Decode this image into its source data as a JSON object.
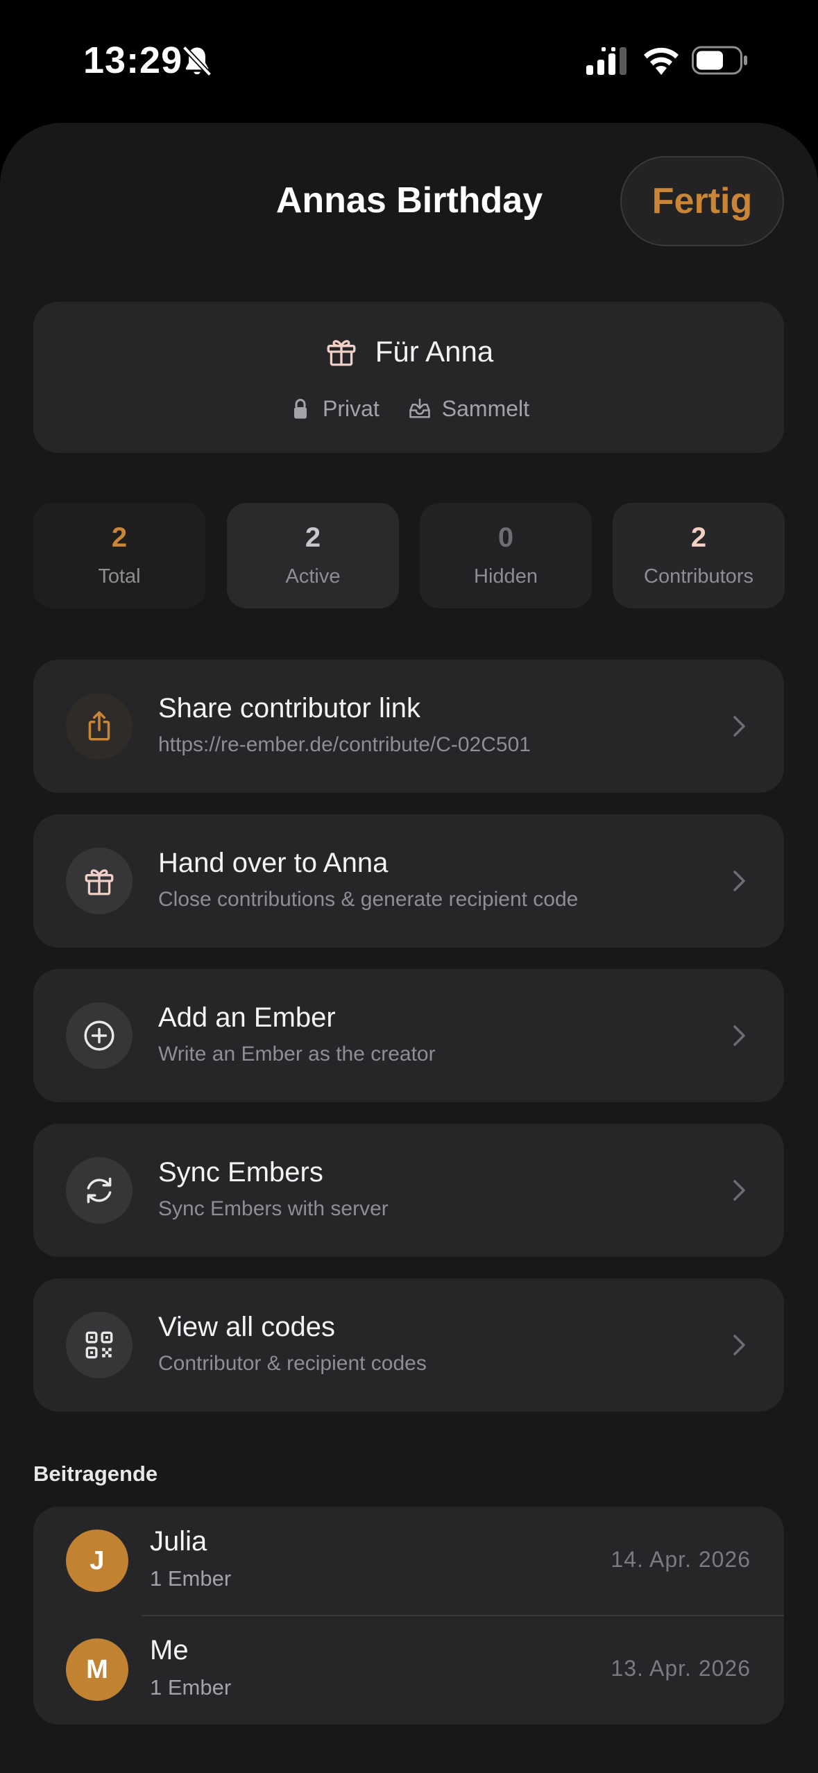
{
  "status_bar": {
    "time": "13:29"
  },
  "header": {
    "title": "Annas Birthday",
    "done_label": "Fertig"
  },
  "recipient": {
    "name": "Für Anna",
    "privacy": "Privat",
    "state": "Sammelt"
  },
  "stats": [
    {
      "value": "2",
      "label": "Total"
    },
    {
      "value": "2",
      "label": "Active"
    },
    {
      "value": "0",
      "label": "Hidden"
    },
    {
      "value": "2",
      "label": "Contributors"
    }
  ],
  "actions": [
    {
      "title": "Share contributor link",
      "subtitle": "https://re-ember.de/contribute/C-02C501",
      "icon": "share-icon"
    },
    {
      "title": "Hand over to Anna",
      "subtitle": "Close contributions & generate recipient code",
      "icon": "gift-icon"
    },
    {
      "title": "Add an Ember",
      "subtitle": "Write an Ember as the creator",
      "icon": "plus-circle-icon"
    },
    {
      "title": "Sync Embers",
      "subtitle": "Sync Embers with server",
      "icon": "sync-icon"
    },
    {
      "title": "View all codes",
      "subtitle": "Contributor & recipient codes",
      "icon": "qr-code-icon"
    }
  ],
  "contributors": {
    "header": "Beitragende",
    "items": [
      {
        "initial": "J",
        "name": "Julia",
        "count": "1 Ember",
        "date": "14. Apr. 2026"
      },
      {
        "initial": "M",
        "name": "Me",
        "count": "1 Ember",
        "date": "13. Apr. 2026"
      }
    ]
  },
  "colors": {
    "accent": "#c98637",
    "background": "#18181a",
    "card": "#262629",
    "avatar": "#c18232"
  }
}
